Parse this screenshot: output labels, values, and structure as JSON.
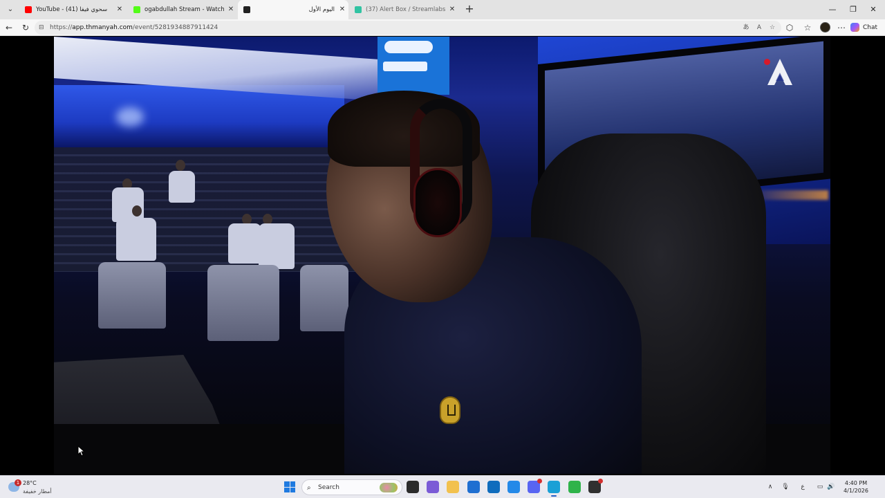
{
  "browser": {
    "tabs": [
      {
        "label": "YouTube - سحوي فيفا (41)",
        "active": false,
        "favicon_color": "#ff0000",
        "direction": "ltr"
      },
      {
        "label": "ogabdullah Stream - Watch Live o",
        "active": false,
        "favicon_color": "#53fc18",
        "direction": "ltr"
      },
      {
        "label": "اليوم الأول",
        "active": true,
        "favicon_color": "#222222",
        "direction": "rtl"
      },
      {
        "label": "(37) Alert Box / Streamlabs",
        "active": false,
        "favicon_color": "#31c3a2",
        "direction": "ltr"
      }
    ],
    "tab_close_glyph": "✕",
    "new_tab_glyph": "+",
    "tab_menu_glyph": "⌄",
    "window_controls": {
      "minimize": "—",
      "restore": "❐",
      "close": "✕"
    },
    "nav": {
      "back": "←",
      "refresh": "↻"
    },
    "url_prefix": "https://",
    "url_host": "app.thmanyah.com",
    "url_path": "/event/5281934887911424",
    "toolbar_icons": [
      "translate-icon",
      "read-aloud-icon",
      "favorite-star-icon",
      "extensions-icon",
      "favorites-icon",
      "profile-avatar",
      "more-menu-icon"
    ],
    "toolbar_glyphs": {
      "translate": "あ",
      "read_aloud": "A",
      "favorite": "☆",
      "extensions": "⬡",
      "favorites": "☆",
      "more": "⋯"
    },
    "chat_label": "Chat"
  },
  "video": {
    "player_badge_colors": {
      "live_dot": "#d71a2a",
      "logo": "#ffffff"
    }
  },
  "taskbar": {
    "weather": {
      "temp": "28°C",
      "description": "أمطار خفيفة",
      "alert_count": "1"
    },
    "search_label": "Search",
    "search_glyph": "⌕",
    "tray": {
      "chevron": "∧",
      "mic": "🎙",
      "lang": "ع",
      "display": "▭",
      "speaker": "🔊"
    },
    "clock": {
      "time": "4:40 PM",
      "date": "4/1/2026"
    },
    "apps": [
      {
        "name": "file-manager-icon",
        "color": "#2b2b2b",
        "active": false
      },
      {
        "name": "gallery-app-icon",
        "color": "#7b5bd6",
        "active": false
      },
      {
        "name": "file-explorer-icon",
        "color": "#f2c14e",
        "active": false
      },
      {
        "name": "microsoft-store-icon",
        "color": "#1f6fd1",
        "active": false
      },
      {
        "name": "outlook-icon",
        "color": "#0f6cbd",
        "active": false
      },
      {
        "name": "edge-copilot-icon",
        "color": "#2489e8",
        "active": false
      },
      {
        "name": "discord-icon",
        "color": "#5865f2",
        "active": false
      },
      {
        "name": "edge-browser-icon",
        "color": "#1aa0d6",
        "active": true
      },
      {
        "name": "green-app-icon",
        "color": "#2fb34a",
        "active": false
      },
      {
        "name": "obs-studio-icon",
        "color": "#303030",
        "active": false
      }
    ]
  }
}
